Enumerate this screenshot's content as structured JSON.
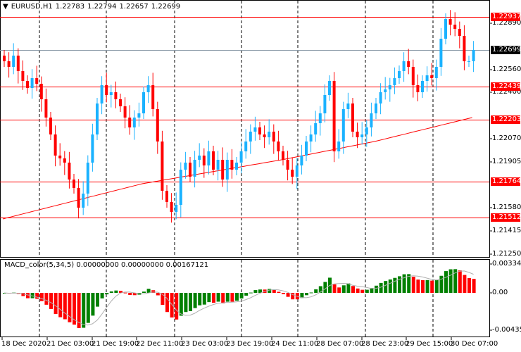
{
  "header": {
    "symbol": "EURUSD,H1",
    "open": "1.22783",
    "high": "1.22794",
    "low": "1.22657",
    "close": "1.22699"
  },
  "macd": {
    "label": "MACD_color(5,34,5) 0.00000000 0.00000000 0.00167121",
    "axis": [
      "0.0033484",
      "0.00",
      "-0.004359"
    ],
    "max": 0.0033484,
    "min": -0.004359
  },
  "price_axis": [
    "1.22890",
    "1.22560",
    "1.22400",
    "1.22070",
    "1.21905",
    "1.21580",
    "1.21415",
    "1.21250"
  ],
  "levels": [
    {
      "price": 1.22937,
      "label": "1.22937",
      "color": "#ff0000"
    },
    {
      "price": 1.22439,
      "label": "1.22439",
      "color": "#ff0000"
    },
    {
      "price": 1.22203,
      "label": "1.22203",
      "color": "#ff0000"
    },
    {
      "price": 1.21764,
      "label": "1.21764",
      "color": "#ff0000"
    },
    {
      "price": 1.21512,
      "label": "1.21512",
      "color": "#ff0000"
    }
  ],
  "bid": {
    "price": 1.22699,
    "label": "1.22699"
  },
  "time_axis": [
    "18 Dec 2020",
    "21 Dec 03:00",
    "21 Dec 19:00",
    "22 Dec 11:00",
    "23 Dec 03:00",
    "23 Dec 19:00",
    "24 Dec 11:00",
    "28 Dec 07:00",
    "28 Dec 23:00",
    "29 Dec 15:00",
    "30 Dec 07:00"
  ],
  "colors": {
    "bull": "#1ab2ff",
    "bear": "#ff0000",
    "ma": "#ff0000",
    "macd_up": "#008000",
    "macd_down": "#ff0000",
    "signal": "#b0b0b0"
  },
  "chart_data": {
    "type": "candlestick",
    "closes": [
      1.2262,
      1.2258,
      1.2266,
      1.2255,
      1.2248,
      1.2243,
      1.225,
      1.2246,
      1.2235,
      1.2222,
      1.221,
      1.2195,
      1.2193,
      1.219,
      1.2178,
      1.2172,
      1.2158,
      1.2168,
      1.219,
      1.221,
      1.2232,
      1.2245,
      1.2238,
      1.224,
      1.2235,
      1.223,
      1.2222,
      1.2215,
      1.2222,
      1.2225,
      1.224,
      1.2245,
      1.2228,
      1.2205,
      1.217,
      1.2162,
      1.2155,
      1.216,
      1.2185,
      1.219,
      1.218,
      1.2192,
      1.2195,
      1.2188,
      1.2198,
      1.2185,
      1.2192,
      1.2178,
      1.2192,
      1.2185,
      1.219,
      1.2198,
      1.2205,
      1.2212,
      1.2215,
      1.221,
      1.2208,
      1.2212,
      1.2205,
      1.2198,
      1.2192,
      1.2185,
      1.218,
      1.2188,
      1.2195,
      1.2205,
      1.221,
      1.2218,
      1.2225,
      1.2238,
      1.2248,
      1.2198,
      1.2205,
      1.2228,
      1.2232,
      1.2212,
      1.2208,
      1.221,
      1.2215,
      1.2225,
      1.2232,
      1.224,
      1.2242,
      1.2245,
      1.225,
      1.2255,
      1.2262,
      1.2258,
      1.2245,
      1.224,
      1.2248,
      1.2252,
      1.225,
      1.2258,
      1.2278,
      1.2292,
      1.2288,
      1.2285,
      1.228,
      1.2262,
      1.2262,
      1.227
    ],
    "ma_keypoints": [
      [
        0,
        1.215
      ],
      [
        30,
        1.2175
      ],
      [
        60,
        1.2192
      ],
      [
        80,
        1.2205
      ],
      [
        101,
        1.2222
      ]
    ]
  }
}
